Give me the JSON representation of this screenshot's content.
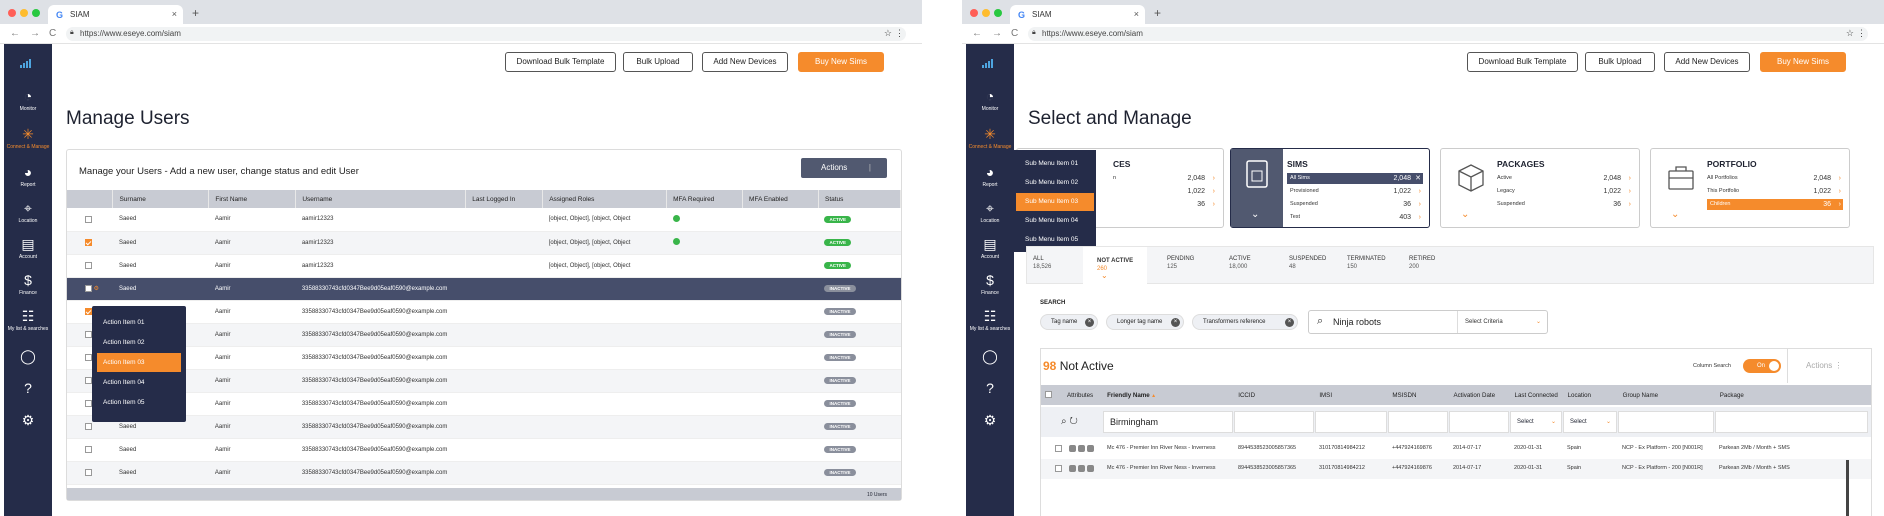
{
  "browser": {
    "tab_title": "SIAM",
    "url": "https://www.eseye.com/siam",
    "google_icon": "G",
    "close": "×",
    "new_tab": "+",
    "star": "☆",
    "menu": "⋮",
    "back": "←",
    "forward": "→",
    "reload": "C"
  },
  "sidebar": {
    "items": [
      {
        "label": "Monitor",
        "icon": "gauge-icon"
      },
      {
        "label": "Connect & Manage",
        "icon": "network-icon"
      },
      {
        "label": "Report",
        "icon": "pie-chart-icon"
      },
      {
        "label": "Location",
        "icon": "location-pin-icon"
      },
      {
        "label": "Account",
        "icon": "document-icon"
      },
      {
        "label": "Finance",
        "icon": "dollar-icon"
      },
      {
        "label": "My list & searches",
        "icon": "list-icon"
      },
      {
        "label": "",
        "icon": "user-icon"
      },
      {
        "label": "",
        "icon": "help-icon"
      },
      {
        "label": "",
        "icon": "settings-icon"
      }
    ]
  },
  "toolbar": {
    "download_bulk_template": "Download Bulk Template",
    "bulk_upload": "Bulk Upload",
    "add_new_devices": "Add New Devices",
    "buy_new_sims": "Buy New Sims"
  },
  "manage_users": {
    "page_title": "Manage Users",
    "card_title": "Manage your Users - Add a new user, change status and edit User",
    "actions_label": "Actions",
    "actions_sep": "|",
    "columns": [
      "Surname",
      "First Name",
      "Username",
      "Last Logged In",
      "Assigned Roles",
      "MFA Required",
      "MFA Enabled",
      "Status"
    ],
    "rows": [
      {
        "surname": "Saeed",
        "first": "Aamir",
        "username": "aamir12323",
        "roles": "[object, Object], [object, Object",
        "mfa": true,
        "status": "ACTIVE"
      },
      {
        "surname": "Saeed",
        "first": "Aamir",
        "username": "aamir12323",
        "roles": "[object, Object], [object, Object",
        "mfa": true,
        "status": "ACTIVE"
      },
      {
        "surname": "Saeed",
        "first": "Aamir",
        "username": "aamir12323",
        "roles": "[object, Object], [object, Object",
        "mfa": false,
        "status": "ACTIVE"
      },
      {
        "surname": "Saeed",
        "first": "Aamir",
        "username": "33588330743cfd0347Bee9d05eaf0590@example.com",
        "roles": "",
        "mfa": false,
        "status": "INACTIVE"
      },
      {
        "surname": "Saeed",
        "first": "Aamir",
        "username": "33588330743cfd0347Bee9d05eaf0590@example.com",
        "roles": "",
        "mfa": false,
        "status": "INACTIVE"
      },
      {
        "surname": "Saeed",
        "first": "Aamir",
        "username": "33588330743cfd0347Bee9d05eaf0590@example.com",
        "roles": "",
        "mfa": false,
        "status": "INACTIVE"
      },
      {
        "surname": "Saeed",
        "first": "Aamir",
        "username": "33588330743cfd0347Bee9d05eaf0590@example.com",
        "roles": "",
        "mfa": false,
        "status": "INACTIVE"
      },
      {
        "surname": "Saeed",
        "first": "Aamir",
        "username": "33588330743cfd0347Bee9d05eaf0590@example.com",
        "roles": "",
        "mfa": false,
        "status": "INACTIVE"
      },
      {
        "surname": "Saeed",
        "first": "Aamir",
        "username": "33588330743cfd0347Bee9d05eaf0590@example.com",
        "roles": "",
        "mfa": false,
        "status": "INACTIVE"
      },
      {
        "surname": "Saeed",
        "first": "Aamir",
        "username": "33588330743cfd0347Bee9d05eaf0590@example.com",
        "roles": "",
        "mfa": false,
        "status": "INACTIVE"
      },
      {
        "surname": "Saeed",
        "first": "Aamir",
        "username": "33588330743cfd0347Bee9d05eaf0590@example.com",
        "roles": "",
        "mfa": false,
        "status": "INACTIVE"
      },
      {
        "surname": "Saeed",
        "first": "Aamir",
        "username": "33588330743cfd0347Bee9d05eaf0590@example.com",
        "roles": "",
        "mfa": false,
        "status": "INACTIVE"
      }
    ],
    "footer": "10 Users",
    "popup_items": [
      "Action Item 01",
      "Action Item 02",
      "Action Item 03",
      "Action Item 04",
      "Action Item 05"
    ]
  },
  "select_manage": {
    "page_title": "Select and Manage",
    "submenu_items": [
      "Sub Menu Item 01",
      "Sub Menu Item 02",
      "Sub Menu Item 03",
      "Sub Menu Item 04",
      "Sub Menu Item 05"
    ],
    "devices_tile": {
      "title": "CES",
      "rows": [
        {
          "label": "n",
          "value": "2,048"
        },
        {
          "label": "",
          "value": "1,022"
        },
        {
          "label": "",
          "value": "36"
        }
      ]
    },
    "sims_tile": {
      "title": "SIMS",
      "rows": [
        {
          "label": "All Sims",
          "value": "2,048"
        },
        {
          "label": "Provisioned",
          "value": "1,022"
        },
        {
          "label": "Suspended",
          "value": "36"
        },
        {
          "label": "Test",
          "value": "403"
        }
      ]
    },
    "packages_tile": {
      "title": "PACKAGES",
      "rows": [
        {
          "label": "Active",
          "value": "2,048"
        },
        {
          "label": "Legacy",
          "value": "1,022"
        },
        {
          "label": "Suspended",
          "value": "36"
        }
      ]
    },
    "portfolio_tile": {
      "title": "PORTFOLIO",
      "rows": [
        {
          "label": "All Portfolios",
          "value": "2,048"
        },
        {
          "label": "This Portfolio",
          "value": "1,022"
        },
        {
          "label": "Children",
          "value": "36"
        }
      ]
    },
    "status_tabs": [
      {
        "label": "ALL",
        "count": "18,526"
      },
      {
        "label": "NOT ACTIVE",
        "count": "260"
      },
      {
        "label": "PENDING",
        "count": "125"
      },
      {
        "label": "ACTIVE",
        "count": "18,000"
      },
      {
        "label": "SUSPENDED",
        "count": "48"
      },
      {
        "label": "TERMINATED",
        "count": "150"
      },
      {
        "label": "RETIRED",
        "count": "200"
      }
    ],
    "search_label": "SEARCH",
    "chips": [
      "Tag name",
      "Longer tag name",
      "Transformers reference"
    ],
    "search_value": "Ninja robots",
    "search_criteria": "Select Criteria",
    "result_count": "98",
    "result_label": "Not Active",
    "column_search": "Column Search",
    "toggle_label": "On",
    "actions_label": "Actions",
    "columns": [
      "Attributes",
      "Friendly Name",
      "ICCID",
      "IMSI",
      "MSISDN",
      "Activation Date",
      "Last Connected",
      "Location",
      "Group Name",
      "Package"
    ],
    "filter_value": "Birmingham",
    "select_label": "Select",
    "rows": [
      {
        "name": "Mc 476 - Premier Inn River Ness - Inverness",
        "iccid": "8944538523005857365",
        "imsi": "310170814984212",
        "msisdn": "+447924169876",
        "activation": "2014-07-17",
        "last": "2020-01-31",
        "location": "Spain",
        "group": "NCP - Ex Platform - 200 [N001R]",
        "package": "Parkean 2Mb / Month + SMS"
      },
      {
        "name": "Mc 476 - Premier Inn River Ness - Inverness",
        "iccid": "8944538523005857365",
        "imsi": "310170814984212",
        "msisdn": "+447924169876",
        "activation": "2014-07-17",
        "last": "2020-01-31",
        "location": "Spain",
        "group": "NCP - Ex Platform - 200 [N001R]",
        "package": "Parkean 2Mb / Month + SMS"
      }
    ]
  },
  "colors": {
    "navy": "#252c49",
    "accent": "#f58b2c",
    "active_green": "#39b54a",
    "inactive_grey": "#8a8f9c"
  }
}
